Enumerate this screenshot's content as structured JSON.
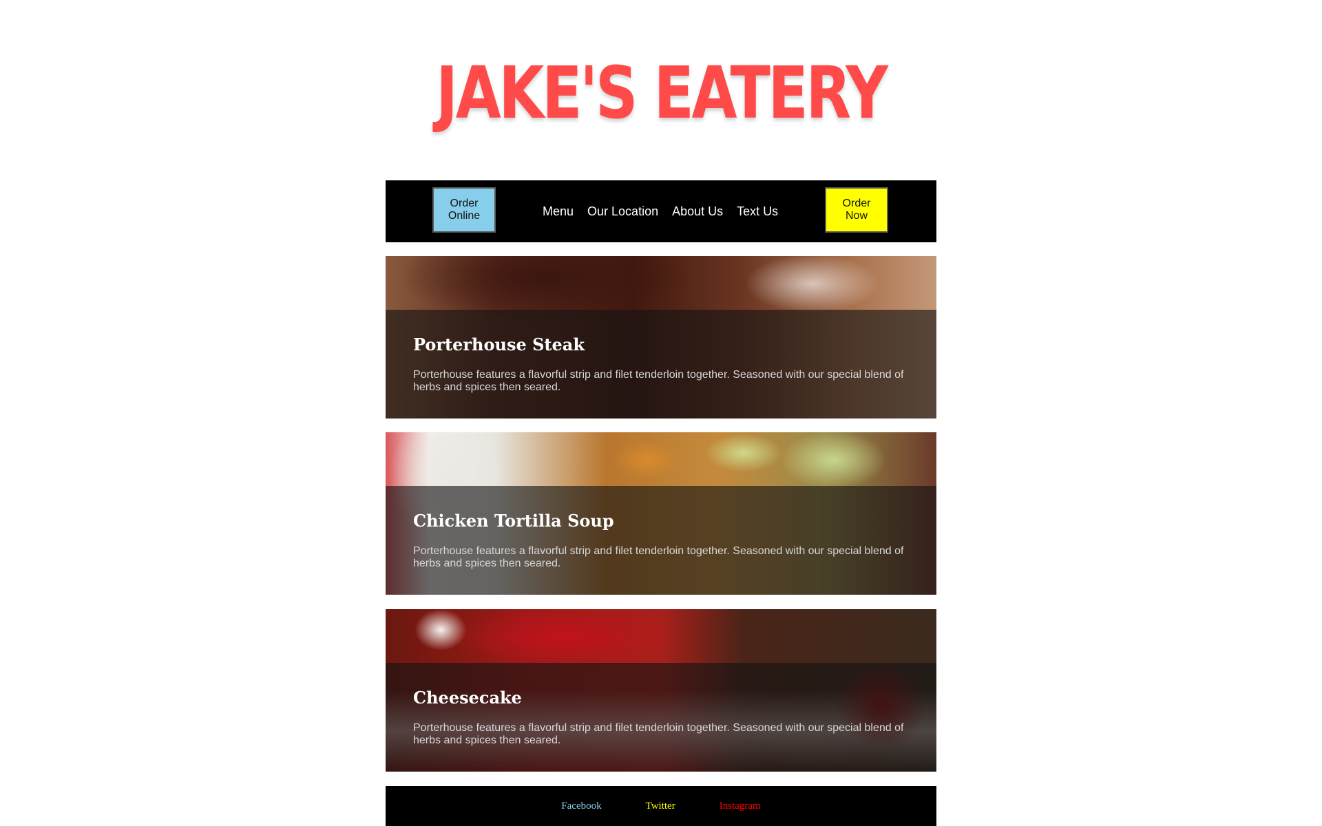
{
  "header": {
    "title": "JAKE'S EATERY"
  },
  "nav": {
    "order_online": "Order Online",
    "order_now": "Order Now",
    "links": [
      "Menu",
      "Our Location",
      "About Us",
      "Text Us"
    ]
  },
  "menu_items": [
    {
      "title": "Porterhouse Steak",
      "description": "Porterhouse features a flavorful strip and filet tenderloin together. Seasoned with our special blend of herbs and spices then seared."
    },
    {
      "title": "Chicken Tortilla Soup",
      "description": "Porterhouse features a flavorful strip and filet tenderloin together. Seasoned with our special blend of herbs and spices then seared."
    },
    {
      "title": "Cheesecake",
      "description": "Porterhouse features a flavorful strip and filet tenderloin together. Seasoned with our special blend of herbs and spices then seared."
    }
  ],
  "footer": {
    "links": [
      "Facebook",
      "Twitter",
      "Instagram"
    ]
  },
  "colors": {
    "title": "#ff4a4a",
    "order_online_bg": "#87ceeb",
    "order_now_bg": "#ffff00",
    "facebook": "#87ceeb",
    "twitter": "#ffff00",
    "instagram": "#ff0000"
  }
}
